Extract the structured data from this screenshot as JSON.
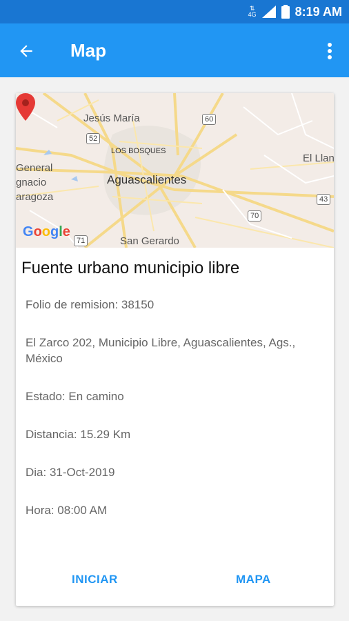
{
  "status_bar": {
    "network_label": "4G",
    "time": "8:19 AM"
  },
  "app_bar": {
    "title": "Map"
  },
  "map": {
    "labels": {
      "jesus_maria": "Jesús María",
      "los_bosques": "LOS BOSQUES",
      "aguascalientes": "Aguascalientes",
      "general": "General",
      "ignacio": "gnacio",
      "zaragoza": "aragoza",
      "el_llano": "El Llan",
      "san_gerardo": "San Gerardo"
    },
    "highways": {
      "h52": "52",
      "h60": "60",
      "h43": "43",
      "h70": "70",
      "h71": "71"
    },
    "google_logo": "Google"
  },
  "card": {
    "title": "Fuente urbano municipio libre",
    "folio": "Folio de remision: 38150",
    "address": "El Zarco 202, Municipio Libre, Aguascalientes, Ags., México",
    "estado": "Estado: En camino",
    "distancia": "Distancia: 15.29 Km",
    "dia": "Dia: 31-Oct-2019",
    "hora": "Hora: 08:00 AM"
  },
  "actions": {
    "iniciar": "INICIAR",
    "mapa": "MAPA"
  },
  "colors": {
    "primary": "#2196f3",
    "primary_dark": "#1976d2",
    "marker": "#e53935"
  }
}
